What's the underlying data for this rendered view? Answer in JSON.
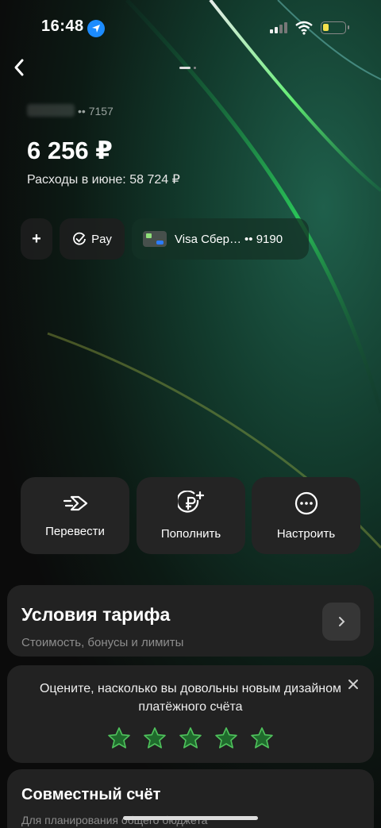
{
  "status_bar": {
    "time": "16:48"
  },
  "account": {
    "number": "•• 7157",
    "balance": "6 256 ₽",
    "spending": "Расходы в июне: 58 724 ₽"
  },
  "chips": {
    "add": "+",
    "pay": "Pay",
    "card_name": "Visa Сбер…",
    "card_number": "•• 9190"
  },
  "actions": [
    {
      "label": "Перевести",
      "icon": "transfer-arrow-icon"
    },
    {
      "label": "Пополнить",
      "icon": "ruble-plus-icon"
    },
    {
      "label": "Настроить",
      "icon": "more-dots-icon"
    }
  ],
  "tariff": {
    "title": "Условия тарифа",
    "subtitle": "Стоимость, бонусы и лимиты"
  },
  "rating": {
    "question": "Оцените, насколько вы довольны новым дизайном платёжного счёта",
    "stars": 5
  },
  "joint": {
    "title": "Совместный счёт",
    "subtitle": "Для планирования общего бюджета"
  },
  "colors": {
    "accent": "#21a038",
    "star_fill": "#1f6a2c",
    "star_stroke": "#4fc25c"
  }
}
